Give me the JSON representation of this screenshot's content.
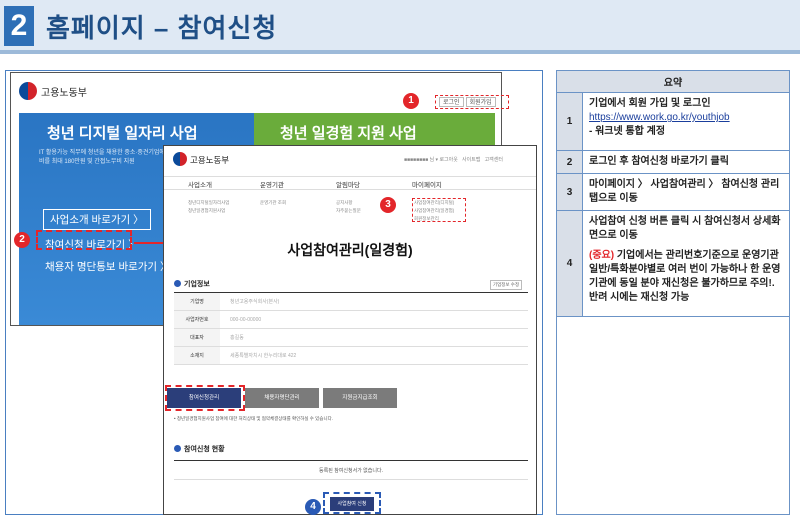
{
  "header": {
    "number": "2",
    "title": "홈페이지 – 참여신청"
  },
  "site1": {
    "org_name": "고용노동부",
    "login_label": "로그인",
    "signup_label": "회원가입",
    "banner_left_title": "청년 디지털 일자리 사업",
    "banner_right_title": "청년 일경험 지원 사업",
    "banner_desc": "IT 활용가능 직무에 청년을 채용한 중소·중견기업에 인건비를 최대 180만원 및 간접노무비 지원",
    "link_intro": "사업소개 바로가기 〉",
    "link_apply": "참여신청 바로가기 〉",
    "link_notice": "채용자 명단통보 바로가기 〉"
  },
  "site2": {
    "org_name": "고용노동부",
    "nav": [
      "사업소개",
      "운영기관",
      "알림마당",
      "마이페이지"
    ],
    "sub_intro": [
      "청년디지털일자리사업",
      "청년일경험지원사업"
    ],
    "sub_org": [
      "운영기관 조회"
    ],
    "sub_notice": [
      "공지사항",
      "자주묻는질문"
    ],
    "sub_mypage": [
      "사업참여관리(디지털)",
      "사업참여관리(일경험)",
      "회원정보관리"
    ],
    "page_title": "사업참여관리(일경험)",
    "section_company": "기업정보",
    "edit_button": "기업정보 수정",
    "info_rows": [
      {
        "key": "기업명",
        "value": "청년고용주식회사(본사)"
      },
      {
        "key": "사업자번호",
        "value": "000-00-00000"
      },
      {
        "key": "대표자",
        "value": "홍길동"
      },
      {
        "key": "소재지",
        "value": "세종특별자치시 한누리대로 422"
      }
    ],
    "tabs": [
      "참여신청관리",
      "채용자명단관리",
      "지원금지급조회"
    ],
    "note": "• 청년일경험지원사업 참여에 대한 처리상태 및 협약체결상태를 확인하실 수 있습니다.",
    "section_status": "참여신청 현황",
    "status_empty": "등록된 참여신청서가 없습니다.",
    "apply_button": "사업참여 신청"
  },
  "markers": [
    "1",
    "2",
    "3",
    "4"
  ],
  "summary": {
    "heading": "요약",
    "rows": [
      {
        "num": "1",
        "text": "기업에서 회원 가입 및 로그인",
        "link": " https://www.work.go.kr/youthjob",
        "sub": " - 워크넷 통합 계정"
      },
      {
        "num": "2",
        "text": "로그인 후 참여신청 바로가기 클릭"
      },
      {
        "num": "3",
        "text": "마이페이지 〉 사업참여관리 〉 참여신청 관리 탭으로 이동"
      },
      {
        "num": "4",
        "text": "사업참여 신청 버튼 클릭 시 참여신청서 상세화면으로 이동",
        "warn": "(중요)",
        "warn_text": " 기업에서는 관리번호기준으로 운영기관 일반/특화분야별로 여러 번이 가능하나 한 운영기관에 동일 분야 재신청은 불가하므로 주의!. 반려 시에는 재신청 가능"
      }
    ]
  },
  "colors": {
    "accent_red": "#e3262a",
    "accent_blue": "#2a5ab5",
    "header_bg": "#dfe9f4"
  }
}
